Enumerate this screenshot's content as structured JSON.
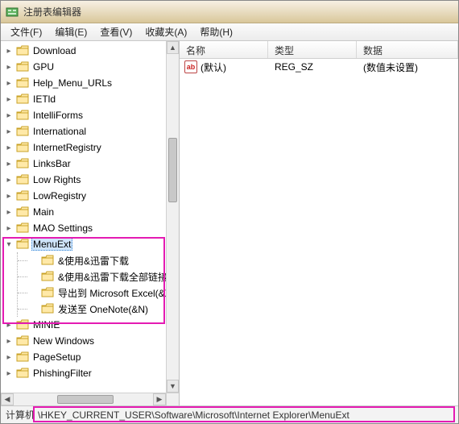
{
  "window": {
    "title": "注册表编辑器"
  },
  "menus": {
    "file": "文件(F)",
    "edit": "编辑(E)",
    "view": "查看(V)",
    "favorites": "收藏夹(A)",
    "help": "帮助(H)"
  },
  "tree": {
    "items": [
      {
        "label": "Download"
      },
      {
        "label": "GPU"
      },
      {
        "label": "Help_Menu_URLs"
      },
      {
        "label": "IETld"
      },
      {
        "label": "IntelliForms"
      },
      {
        "label": "International"
      },
      {
        "label": "InternetRegistry"
      },
      {
        "label": "LinksBar"
      },
      {
        "label": "Low Rights"
      },
      {
        "label": "LowRegistry"
      },
      {
        "label": "Main"
      },
      {
        "label": "MAO Settings"
      },
      {
        "label": "MenuExt",
        "selected": true,
        "expanded": true,
        "children": [
          {
            "label": "&使用&迅雷下载"
          },
          {
            "label": "&使用&迅雷下载全部链接"
          },
          {
            "label": "导出到 Microsoft Excel(&X"
          },
          {
            "label": "发送至 OneNote(&N)"
          }
        ]
      },
      {
        "label": "MINIE"
      },
      {
        "label": "New Windows"
      },
      {
        "label": "PageSetup"
      },
      {
        "label": "PhishingFilter"
      }
    ]
  },
  "list": {
    "columns": {
      "name": "名称",
      "type": "类型",
      "data": "数据"
    },
    "rows": [
      {
        "name": "(默认)",
        "type": "REG_SZ",
        "data": "(数值未设置)",
        "icon": "string-value-icon",
        "icon_text": "ab"
      }
    ]
  },
  "status": {
    "prefix": "计算机",
    "path": "\\HKEY_CURRENT_USER\\Software\\Microsoft\\Internet Explorer\\MenuExt"
  }
}
